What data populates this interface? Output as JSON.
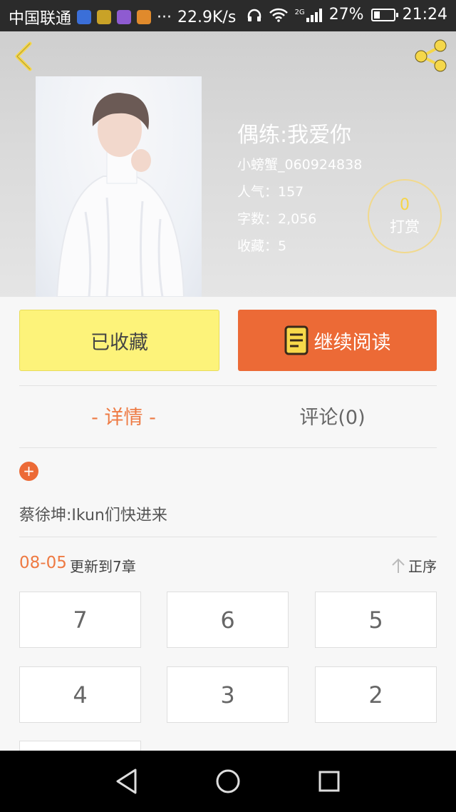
{
  "status_bar": {
    "carrier": "中国联通",
    "speed": "22.9K/s",
    "network": "2G",
    "battery": "27%",
    "time": "21:24",
    "dots": "···"
  },
  "book": {
    "title": "偶练:我爱你",
    "author": "小螃蟹_060924838",
    "popularity": "人气：157",
    "word_count": "字数：2,056",
    "favorites": "收藏：5"
  },
  "reward": {
    "count": "0",
    "label": "打赏"
  },
  "actions": {
    "favorited_label": "已收藏",
    "continue_label": "继续阅读"
  },
  "tabs": {
    "detail": "- 详情 -",
    "comment": "评论(0)"
  },
  "intro": {
    "expand": "+",
    "description": "蔡徐坤:Ikun们快进来"
  },
  "update": {
    "date": "08-05",
    "text": "更新到7章",
    "sort_label": "正序"
  },
  "chapters": [
    "7",
    "6",
    "5",
    "4",
    "3",
    "2"
  ],
  "colors": {
    "accent": "#ec6a36",
    "favorite_bg": "#fdf37a",
    "tab_active": "#ee7a43"
  }
}
